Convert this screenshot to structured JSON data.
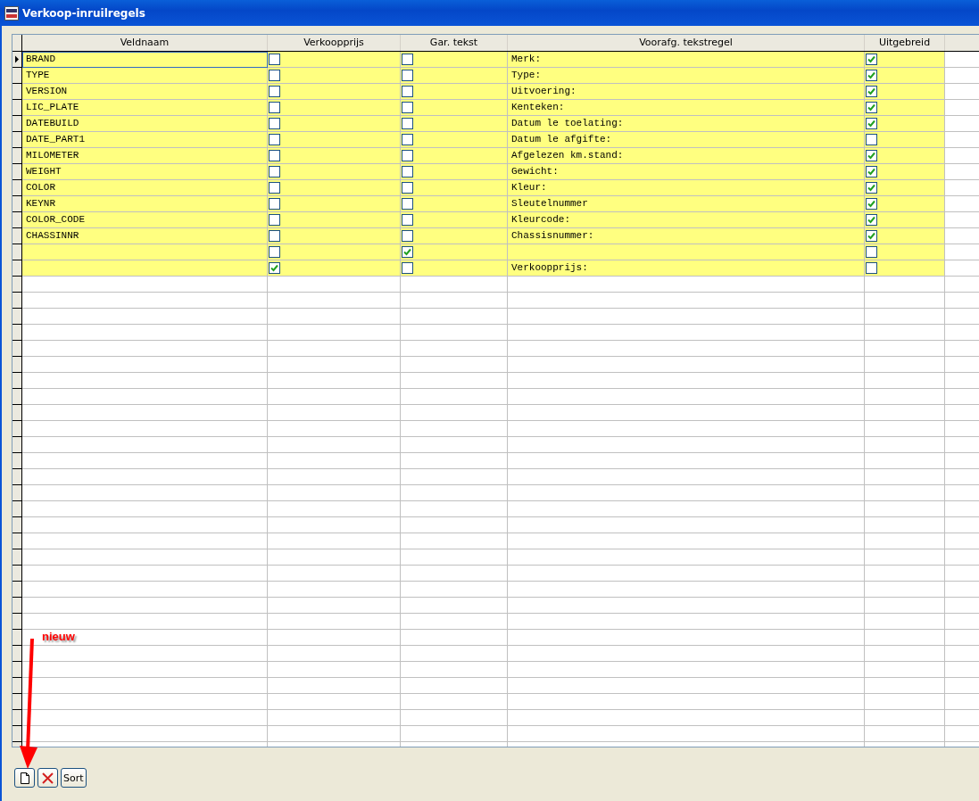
{
  "window": {
    "title": "Verkoop-inruilregels"
  },
  "table": {
    "columns": [
      "Veldnaam",
      "Verkoopprijs",
      "Gar. tekst",
      "Voorafg. tekstregel",
      "Uitgebreid"
    ],
    "rows": [
      {
        "veldnaam": "BRAND",
        "verkoopprijs": false,
        "gar_tekst": false,
        "voorafg": "Merk:",
        "uitgebreid": true,
        "selected": true
      },
      {
        "veldnaam": "TYPE",
        "verkoopprijs": false,
        "gar_tekst": false,
        "voorafg": "Type:",
        "uitgebreid": true,
        "selected": false
      },
      {
        "veldnaam": "VERSION",
        "verkoopprijs": false,
        "gar_tekst": false,
        "voorafg": "Uitvoering:",
        "uitgebreid": true,
        "selected": false
      },
      {
        "veldnaam": "LIC_PLATE",
        "verkoopprijs": false,
        "gar_tekst": false,
        "voorafg": "Kenteken:",
        "uitgebreid": true,
        "selected": false
      },
      {
        "veldnaam": "DATEBUILD",
        "verkoopprijs": false,
        "gar_tekst": false,
        "voorafg": "Datum le toelating:",
        "uitgebreid": true,
        "selected": false
      },
      {
        "veldnaam": "DATE_PART1",
        "verkoopprijs": false,
        "gar_tekst": false,
        "voorafg": "Datum le afgifte:",
        "uitgebreid": false,
        "selected": false
      },
      {
        "veldnaam": "MILOMETER",
        "verkoopprijs": false,
        "gar_tekst": false,
        "voorafg": "Afgelezen km.stand:",
        "uitgebreid": true,
        "selected": false
      },
      {
        "veldnaam": "WEIGHT",
        "verkoopprijs": false,
        "gar_tekst": false,
        "voorafg": "Gewicht:",
        "uitgebreid": true,
        "selected": false
      },
      {
        "veldnaam": "COLOR",
        "verkoopprijs": false,
        "gar_tekst": false,
        "voorafg": "Kleur:",
        "uitgebreid": true,
        "selected": false
      },
      {
        "veldnaam": "KEYNR",
        "verkoopprijs": false,
        "gar_tekst": false,
        "voorafg": "Sleutelnummer",
        "uitgebreid": true,
        "selected": false
      },
      {
        "veldnaam": "COLOR_CODE",
        "verkoopprijs": false,
        "gar_tekst": false,
        "voorafg": "Kleurcode:",
        "uitgebreid": true,
        "selected": false
      },
      {
        "veldnaam": "CHASSINNR",
        "verkoopprijs": false,
        "gar_tekst": false,
        "voorafg": "Chassisnummer:",
        "uitgebreid": true,
        "selected": false
      },
      {
        "verkoopprijs": false,
        "gar_tekst": true,
        "uitgebreid": false,
        "selected": false
      },
      {
        "verkoopprijs": true,
        "gar_tekst": false,
        "voorafg": "Verkoopprijs:",
        "uitgebreid": false,
        "selected": false
      }
    ]
  },
  "buttons": [
    {
      "kind": "new"
    },
    {
      "kind": "delete"
    },
    {
      "kind": "text",
      "label": "Sort"
    }
  ],
  "annotation": {
    "label": "nieuw"
  }
}
